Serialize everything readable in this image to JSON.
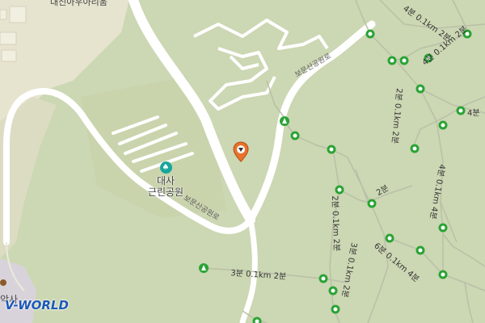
{
  "map": {
    "top_label": "대신아우아리움",
    "park_name_line1": "대사",
    "park_name_line2": "근린공원",
    "road_label_1": "보문산공원로",
    "road_label_2": "보문산공원로",
    "trail_label_bottom": "3분 0.1km 2분",
    "trail_label_v1": "2분 0.1km 2분",
    "trail_label_v2": "2분 0.1km 2분",
    "trail_label_v3": "4분 0.1km 4분",
    "trail_label_v4": "3분 0.1km 2분",
    "trail_label_v5": "6분 0.1km 4분",
    "trail_label_top": "4분 0.1km 2분",
    "trail_label_top2": "4분 0.1km 2분",
    "trail_label_right": "4분",
    "trail_label_right2": "2분",
    "logo_text": "V-WORLD",
    "bottom_left_label": "악사",
    "icons": [
      "park-icon",
      "location-pin-icon",
      "trail-node-icon",
      "direction-arrow-icon"
    ]
  }
}
